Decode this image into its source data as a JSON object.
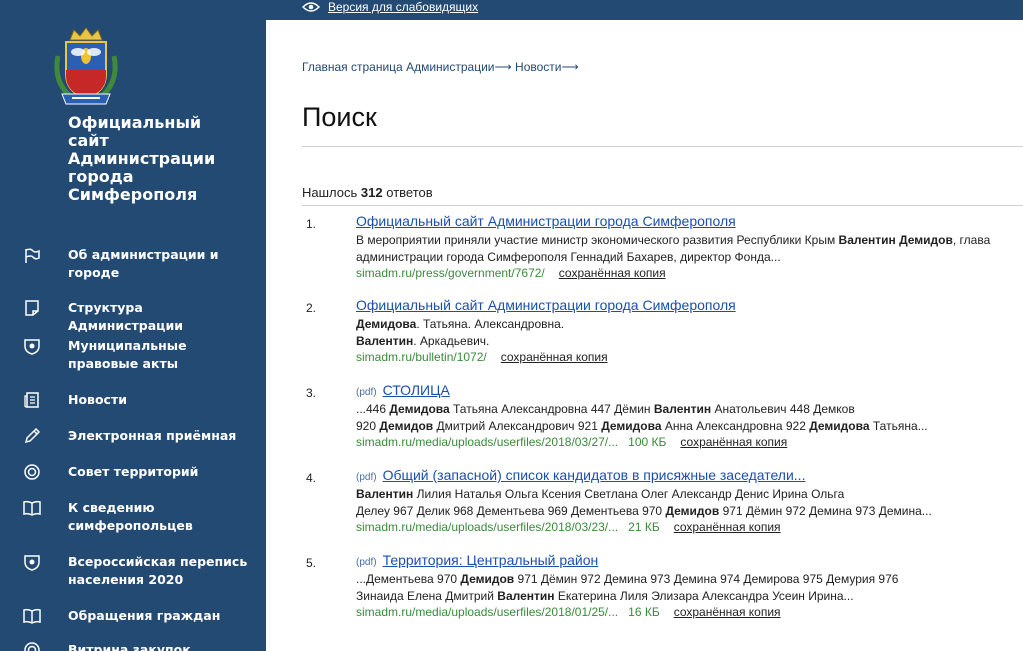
{
  "topbar": {
    "vision_label": "Версия для слабовидящих"
  },
  "sidebar": {
    "site_title": "Официальный\nсайт\nАдминистрации\nгорода\nСимферополя",
    "items": [
      {
        "label": "Об администрации и городе",
        "icon": "flag-icon"
      },
      {
        "label": "Структура Администрации",
        "icon": "document-icon"
      },
      {
        "label": "Муниципальные правовые акты",
        "icon": "emblem-icon"
      },
      {
        "label": "Новости",
        "icon": "newspaper-icon"
      },
      {
        "label": "Электронная приёмная",
        "icon": "pencil-icon"
      },
      {
        "label": "Совет территорий",
        "icon": "target-icon"
      },
      {
        "label": "К сведению симферопольцев",
        "icon": "book-icon"
      },
      {
        "label": "Всероссийская перепись населения 2020",
        "icon": "emblem-icon"
      },
      {
        "label": "Обращения граждан",
        "icon": "book-icon"
      },
      {
        "label": "Витрина закупок",
        "icon": "target-icon"
      }
    ]
  },
  "breadcrumb": {
    "home": "Главная страница Администрации",
    "news": "Новости",
    "arrow": "⟶"
  },
  "page_title": "Поиск",
  "found": {
    "prefix": "Нашлось",
    "count": "312",
    "suffix": "ответов"
  },
  "results": [
    {
      "num": "1.",
      "type": "",
      "title": "Официальный сайт Администрации города Симферополя",
      "snippet_parts": [
        [
          "В мероприятии приняли участие министр экономического развития Республики Крым ",
          false
        ],
        [
          "Валентин Демидов",
          true
        ],
        [
          ", глава администрации города Симферополя Геннадий Бахарев, директор Фонда...",
          false
        ]
      ],
      "url": "simadm.ru/press/government/7672/",
      "size": "",
      "cache": "сохранённая копия"
    },
    {
      "num": "2.",
      "type": "",
      "title": "Официальный сайт Администрации города Симферополя",
      "snippet_parts": [
        [
          "Демидова",
          true
        ],
        [
          ". Татьяна. Александровна.",
          false
        ],
        [
          "\n",
          false
        ],
        [
          "Валентин",
          true
        ],
        [
          ". Аркадьевич.",
          false
        ]
      ],
      "url": "simadm.ru/bulletin/1072/",
      "size": "",
      "cache": "сохранённая копия"
    },
    {
      "num": "3.",
      "type": "(pdf)",
      "title": "СТОЛИЦА",
      "snippet_parts": [
        [
          "...446 ",
          false
        ],
        [
          "Демидова",
          true
        ],
        [
          " Татьяна Александровна 447 Дёмин ",
          false
        ],
        [
          "Валентин",
          true
        ],
        [
          " Анатольевич 448 Демков",
          false
        ],
        [
          "\n",
          false
        ],
        [
          "920 ",
          false
        ],
        [
          "Демидов",
          true
        ],
        [
          " Дмитрий Александрович 921 ",
          false
        ],
        [
          "Демидова",
          true
        ],
        [
          " Анна Александровна 922 ",
          false
        ],
        [
          "Демидова",
          true
        ],
        [
          " Татьяна...",
          false
        ]
      ],
      "url": "simadm.ru/media/uploads/userfiles/2018/03/27/...",
      "size": "100 КБ",
      "cache": "сохранённая копия"
    },
    {
      "num": "4.",
      "type": "(pdf)",
      "title": "Общий (запасной) список кандидатов в присяжные заседатели...",
      "snippet_parts": [
        [
          "Валентин",
          true
        ],
        [
          " Лилия Наталья Ольга Ксения Светлана Олег Александр Денис Ирина Ольга",
          false
        ],
        [
          "\n",
          false
        ],
        [
          "Делеу 967 Делик 968 Дементьева 969 Дементьева 970 ",
          false
        ],
        [
          "Демидов",
          true
        ],
        [
          " 971 Дёмин 972 Демина 973 Демина...",
          false
        ]
      ],
      "url": "simadm.ru/media/uploads/userfiles/2018/03/23/...",
      "size": "21 КБ",
      "cache": "сохранённая копия"
    },
    {
      "num": "5.",
      "type": "(pdf)",
      "title": "Территория: Центральный район",
      "snippet_parts": [
        [
          "...Дементьева 970 ",
          false
        ],
        [
          "Демидов",
          true
        ],
        [
          " 971 Дёмин 972 Демина 973 Демина 974 Демирова 975 Демурия 976",
          false
        ],
        [
          "\n",
          false
        ],
        [
          "Зинаида Елена Дмитрий ",
          false
        ],
        [
          "Валентин",
          true
        ],
        [
          " Екатерина Лиля Элизара Александра Усеин Ирина...",
          false
        ]
      ],
      "url": "simadm.ru/media/uploads/userfiles/2018/01/25/...",
      "size": "16 КБ",
      "cache": "сохранённая копия"
    }
  ]
}
